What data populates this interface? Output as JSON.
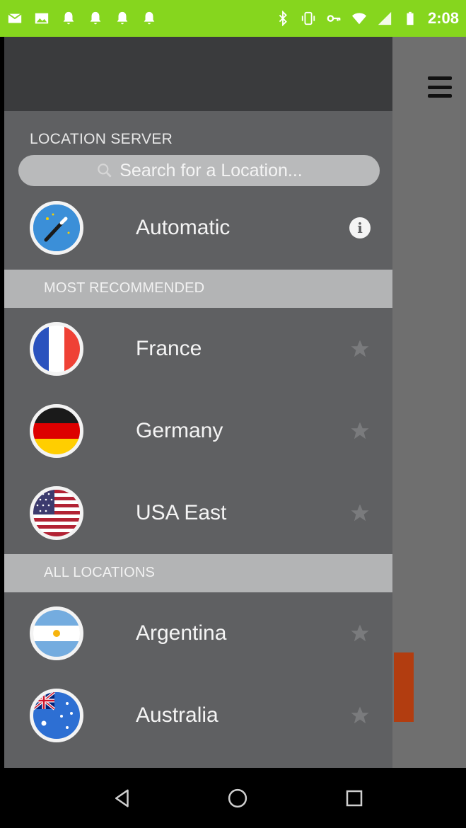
{
  "status_bar": {
    "time": "2:08",
    "left_icons": [
      "messages-icon",
      "gallery-icon",
      "notification-bell-icon",
      "notification-bell-icon",
      "notification-bell-icon",
      "notification-bell-icon"
    ],
    "right_icons": [
      "bluetooth-icon",
      "vibrate-icon",
      "vpn-key-icon",
      "wifi-icon",
      "cell-signal-icon",
      "battery-icon"
    ],
    "color": "#86d61e"
  },
  "drawer": {
    "section_title": "LOCATION SERVER",
    "search_placeholder": "Search for a Location...",
    "automatic": {
      "label": "Automatic",
      "icon": "magic-wand-icon"
    },
    "most_recommended": {
      "header": "MOST RECOMMENDED",
      "items": [
        {
          "label": "France",
          "flag": "france-flag-icon"
        },
        {
          "label": "Germany",
          "flag": "germany-flag-icon"
        },
        {
          "label": "USA East",
          "flag": "usa-flag-icon"
        }
      ]
    },
    "all_locations": {
      "header": "ALL LOCATIONS",
      "items": [
        {
          "label": "Argentina",
          "flag": "argentina-flag-icon"
        },
        {
          "label": "Australia",
          "flag": "australia-flag-icon"
        }
      ]
    }
  },
  "nav_bar": {
    "buttons": [
      "back-icon",
      "home-icon",
      "recents-icon"
    ]
  },
  "colors": {
    "drawer_bg": "#5f6062",
    "drawer_header": "#3a3b3d",
    "group_header": "#b3b4b5",
    "accent_orange": "#b23d10"
  }
}
